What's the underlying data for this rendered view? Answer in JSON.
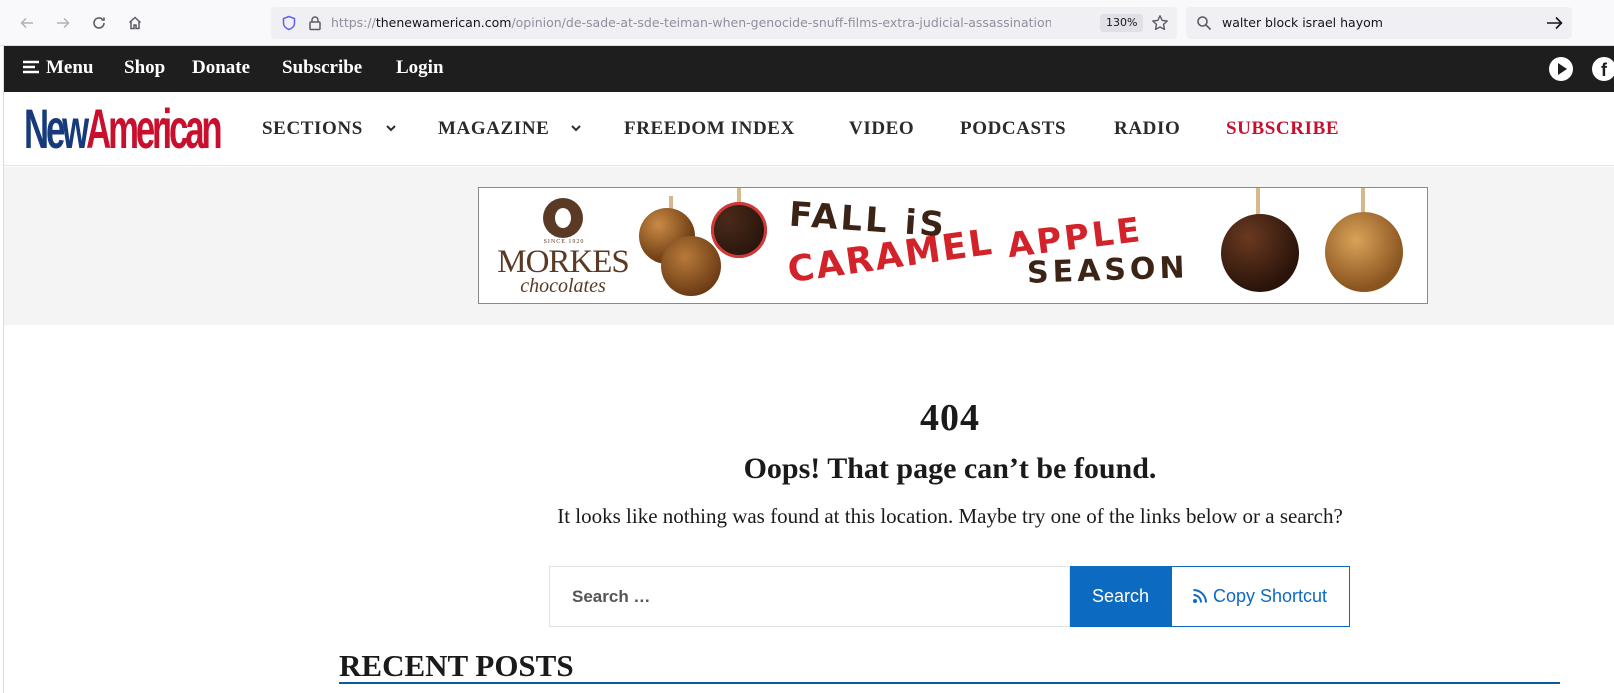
{
  "browser": {
    "url_prefix": "https://",
    "url_host": "thenewamerican.com",
    "url_path": "/opinion/de-sade-at-sde-teiman-when-genocide-snuff-films-extra-judicial-assassinations-rape-a",
    "zoom": "130%",
    "search_query": "walter block israel hayom",
    "icons": [
      "back-icon",
      "forward-icon",
      "reload-icon",
      "home-icon",
      "shield-icon",
      "lock-icon",
      "star-icon",
      "search-icon",
      "arrow-right-icon"
    ]
  },
  "topbar": {
    "menu_label": "Menu",
    "items": [
      "Shop",
      "Donate",
      "Subscribe",
      "Login"
    ],
    "social_icons": [
      "play-icon",
      "facebook-icon"
    ],
    "facebook_glyph": "f"
  },
  "logo": {
    "part1": "New",
    "part2": "American"
  },
  "nav": {
    "items": [
      "SECTIONS",
      "MAGAZINE",
      "FREEDOM INDEX",
      "VIDEO",
      "PODCASTS",
      "RADIO",
      "SUBSCRIBE"
    ],
    "subscribe_color": "#c8102e"
  },
  "ad": {
    "since": "SINCE 1920",
    "brand": "MORKES",
    "brand_sub": "chocolates",
    "line1": "FALL iS",
    "line2": "CARAMEL",
    "line3": "APPLE",
    "line4": "SEASON"
  },
  "content": {
    "code": "404",
    "title": "Oops! That page can’t be found.",
    "description": "It looks like nothing was found at this location. Maybe try one of the links below or a search?",
    "search_placeholder": "Search …",
    "search_button": "Search",
    "copy_button": "Copy Shortcut",
    "recent_heading": "RECENT POSTS"
  },
  "colors": {
    "accent_blue": "#0d6ac1",
    "brand_red": "#c8102e",
    "brand_blue": "#173a7a",
    "topbar_bg": "#1e1e1e"
  }
}
